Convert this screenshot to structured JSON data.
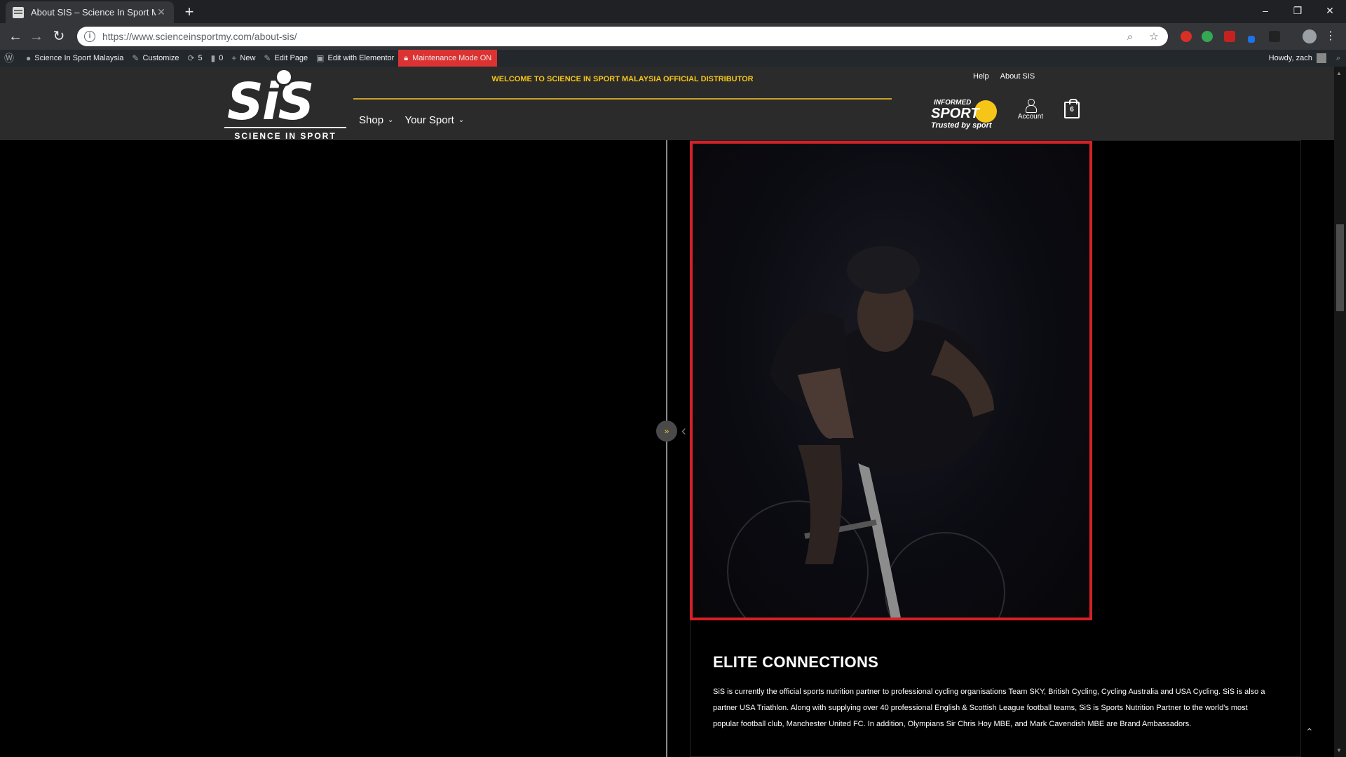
{
  "browser": {
    "tab_title": "About SIS – Science In Sport Mal",
    "tab_close": "✕",
    "new_tab": "+",
    "url": "https://www.scienceinsportmy.com/about-sis/",
    "window_controls": [
      "–",
      "❐",
      "✕"
    ]
  },
  "admin_bar": {
    "site_name": "Science In Sport Malaysia",
    "customize": "Customize",
    "updates_count": "5",
    "comments_count": "0",
    "new": "New",
    "edit_page": "Edit Page",
    "edit_elementor": "Edit with Elementor",
    "maintenance": "Maintenance Mode ON",
    "howdy": "Howdy, zach"
  },
  "header": {
    "logo_text": "SiS",
    "logo_tagline": "SCIENCE IN SPORT",
    "welcome": "WELCOME TO SCIENCE IN SPORT MALAYSIA OFFICIAL DISTRIBUTOR",
    "nav": [
      "Shop",
      "Your Sport"
    ],
    "top_links": [
      "Help",
      "About SIS"
    ],
    "informed_sport": {
      "line1": "INFORMED",
      "line2": "SPORT",
      "line3": "Trusted by sport"
    },
    "account_label": "Account",
    "cart_count": "6"
  },
  "content": {
    "heading": "ELITE CONNECTIONS",
    "body": "SiS is currently the official sports nutrition partner to professional cycling organisations Team SKY, British Cycling, Cycling Australia and USA Cycling. SiS is also a partner USA Triathlon. Along with supplying over 40 professional English & Scottish League football teams, SiS is Sports Nutrition Partner to the world's most popular football club, Manchester United FC. In addition, Olympians Sir Chris Hoy MBE, and Mark Cavendish MBE are Brand Ambassadors."
  },
  "colors": {
    "accent_gold": "#f5c518",
    "highlight_red": "#d61f26",
    "maintenance_red": "#dc3232"
  }
}
